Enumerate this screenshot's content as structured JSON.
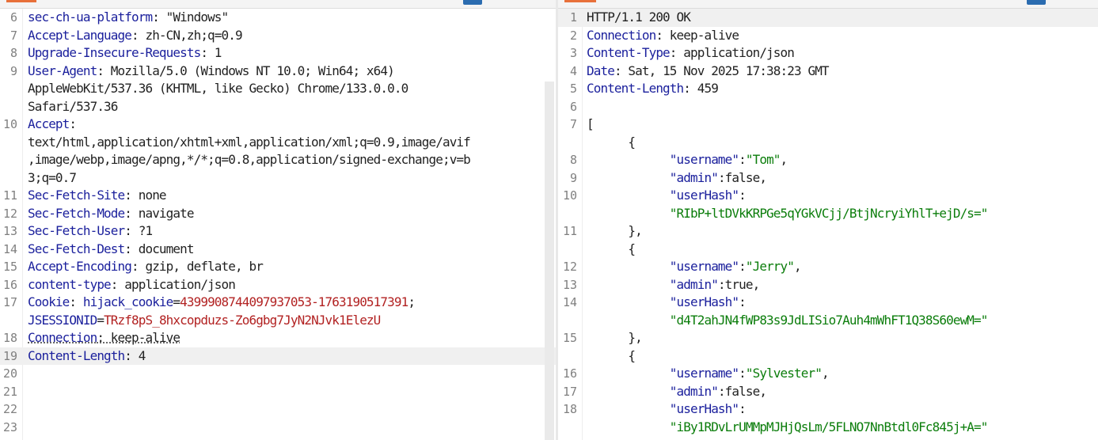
{
  "request": {
    "lines": [
      {
        "n": "6",
        "parts": [
          {
            "t": "sec-ch-ua-platform",
            "c": "k"
          },
          {
            "t": ": \"Windows\""
          }
        ]
      },
      {
        "n": "7",
        "parts": [
          {
            "t": "Accept-Language",
            "c": "k"
          },
          {
            "t": ": zh-CN,zh;q=0.9"
          }
        ]
      },
      {
        "n": "8",
        "parts": [
          {
            "t": "Upgrade-Insecure-Requests",
            "c": "k"
          },
          {
            "t": ": 1"
          }
        ]
      },
      {
        "n": "9",
        "parts": [
          {
            "t": "User-Agent",
            "c": "k"
          },
          {
            "t": ": Mozilla/5.0 (Windows NT 10.0; Win64; x64)"
          }
        ]
      },
      {
        "n": "",
        "parts": [
          {
            "t": "AppleWebKit/537.36 (KHTML, like Gecko) Chrome/133.0.0.0"
          }
        ]
      },
      {
        "n": "",
        "parts": [
          {
            "t": "Safari/537.36"
          }
        ]
      },
      {
        "n": "10",
        "parts": [
          {
            "t": "Accept",
            "c": "k"
          },
          {
            "t": ":"
          }
        ]
      },
      {
        "n": "",
        "parts": [
          {
            "t": "text/html,application/xhtml+xml,application/xml;q=0.9,image/avif"
          }
        ]
      },
      {
        "n": "",
        "parts": [
          {
            "t": ",image/webp,image/apng,*/*;q=0.8,application/signed-exchange;v=b"
          }
        ]
      },
      {
        "n": "",
        "parts": [
          {
            "t": "3;q=0.7"
          }
        ]
      },
      {
        "n": "11",
        "parts": [
          {
            "t": "Sec-Fetch-Site",
            "c": "k"
          },
          {
            "t": ": none"
          }
        ]
      },
      {
        "n": "12",
        "parts": [
          {
            "t": "Sec-Fetch-Mode",
            "c": "k"
          },
          {
            "t": ": navigate"
          }
        ]
      },
      {
        "n": "13",
        "parts": [
          {
            "t": "Sec-Fetch-User",
            "c": "k"
          },
          {
            "t": ": ?1"
          }
        ]
      },
      {
        "n": "14",
        "parts": [
          {
            "t": "Sec-Fetch-Dest",
            "c": "k"
          },
          {
            "t": ": document"
          }
        ]
      },
      {
        "n": "15",
        "parts": [
          {
            "t": "Accept-Encoding",
            "c": "k"
          },
          {
            "t": ": gzip, deflate, br"
          }
        ]
      },
      {
        "n": "16",
        "parts": [
          {
            "t": "content-type",
            "c": "k"
          },
          {
            "t": ": application/json"
          }
        ]
      },
      {
        "n": "17",
        "parts": [
          {
            "t": "Cookie",
            "c": "k"
          },
          {
            "t": ": "
          },
          {
            "t": "hijack_cookie",
            "c": "ck"
          },
          {
            "t": "="
          },
          {
            "t": "4399908744097937053-1763190517391",
            "c": "cv"
          },
          {
            "t": ";"
          }
        ]
      },
      {
        "n": "",
        "parts": [
          {
            "t": "JSESSIONID",
            "c": "ck"
          },
          {
            "t": "="
          },
          {
            "t": "TRzf8pS_8hxcopduzs-Zo6gbg7JyN2NJvk1ElezU",
            "c": "cv"
          }
        ]
      },
      {
        "n": "18",
        "parts": [
          {
            "t": "Connection",
            "c": "k dotted"
          },
          {
            "t": ": keep-alive",
            "c": "dotted"
          }
        ]
      },
      {
        "n": "19",
        "hl": true,
        "parts": [
          {
            "t": "Content-Length",
            "c": "k"
          },
          {
            "t": ": 4"
          }
        ]
      },
      {
        "n": "20",
        "parts": []
      },
      {
        "n": "21",
        "parts": []
      },
      {
        "n": "22",
        "parts": []
      },
      {
        "n": "23",
        "parts": []
      }
    ]
  },
  "response": {
    "lines": [
      {
        "n": "1",
        "hl": true,
        "parts": [
          {
            "t": "HTTP/1.1 200 OK"
          }
        ]
      },
      {
        "n": "2",
        "parts": [
          {
            "t": "Connection",
            "c": "k"
          },
          {
            "t": ": keep-alive"
          }
        ]
      },
      {
        "n": "3",
        "parts": [
          {
            "t": "Content-Type",
            "c": "k"
          },
          {
            "t": ": application/json"
          }
        ]
      },
      {
        "n": "4",
        "parts": [
          {
            "t": "Date",
            "c": "k"
          },
          {
            "t": ": Sat, 15 Nov 2025 17:38:23 GMT"
          }
        ]
      },
      {
        "n": "5",
        "parts": [
          {
            "t": "Content-Length",
            "c": "k"
          },
          {
            "t": ": 459"
          }
        ]
      },
      {
        "n": "6",
        "parts": []
      },
      {
        "n": "7",
        "parts": [
          {
            "t": "["
          }
        ]
      },
      {
        "n": "",
        "parts": [
          {
            "t": "      {"
          }
        ]
      },
      {
        "n": "8",
        "parts": [
          {
            "t": "            "
          },
          {
            "t": "\"username\"",
            "c": "jk"
          },
          {
            "t": ":"
          },
          {
            "t": "\"Tom\"",
            "c": "s"
          },
          {
            "t": ","
          }
        ]
      },
      {
        "n": "9",
        "parts": [
          {
            "t": "            "
          },
          {
            "t": "\"admin\"",
            "c": "jk"
          },
          {
            "t": ":false,"
          }
        ]
      },
      {
        "n": "10",
        "parts": [
          {
            "t": "            "
          },
          {
            "t": "\"userHash\"",
            "c": "jk"
          },
          {
            "t": ":"
          }
        ]
      },
      {
        "n": "",
        "parts": [
          {
            "t": "            "
          },
          {
            "t": "\"RIbP+ltDVkKRPGe5qYGkVCjj/BtjNcryiYhlT+ejD/s=\"",
            "c": "s"
          }
        ]
      },
      {
        "n": "11",
        "parts": [
          {
            "t": "      },"
          }
        ]
      },
      {
        "n": "",
        "parts": [
          {
            "t": "      {"
          }
        ]
      },
      {
        "n": "12",
        "parts": [
          {
            "t": "            "
          },
          {
            "t": "\"username\"",
            "c": "jk"
          },
          {
            "t": ":"
          },
          {
            "t": "\"Jerry\"",
            "c": "s"
          },
          {
            "t": ","
          }
        ]
      },
      {
        "n": "13",
        "parts": [
          {
            "t": "            "
          },
          {
            "t": "\"admin\"",
            "c": "jk"
          },
          {
            "t": ":true,"
          }
        ]
      },
      {
        "n": "14",
        "parts": [
          {
            "t": "            "
          },
          {
            "t": "\"userHash\"",
            "c": "jk"
          },
          {
            "t": ":"
          }
        ]
      },
      {
        "n": "",
        "parts": [
          {
            "t": "            "
          },
          {
            "t": "\"d4T2ahJN4fWP83s9JdLISio7Auh4mWhFT1Q38S60ewM=\"",
            "c": "s"
          }
        ]
      },
      {
        "n": "15",
        "parts": [
          {
            "t": "      },"
          }
        ]
      },
      {
        "n": "",
        "parts": [
          {
            "t": "      {"
          }
        ]
      },
      {
        "n": "16",
        "parts": [
          {
            "t": "            "
          },
          {
            "t": "\"username\"",
            "c": "jk"
          },
          {
            "t": ":"
          },
          {
            "t": "\"Sylvester\"",
            "c": "s"
          },
          {
            "t": ","
          }
        ]
      },
      {
        "n": "17",
        "parts": [
          {
            "t": "            "
          },
          {
            "t": "\"admin\"",
            "c": "jk"
          },
          {
            "t": ":false,"
          }
        ]
      },
      {
        "n": "18",
        "parts": [
          {
            "t": "            "
          },
          {
            "t": "\"userHash\"",
            "c": "jk"
          },
          {
            "t": ":"
          }
        ]
      },
      {
        "n": "",
        "parts": [
          {
            "t": "            "
          },
          {
            "t": "\"iBy1RDvLrUMMpMJHjQsLm/5FLNO7NnBtdl0Fc845j+A=\"",
            "c": "s"
          }
        ]
      }
    ]
  }
}
